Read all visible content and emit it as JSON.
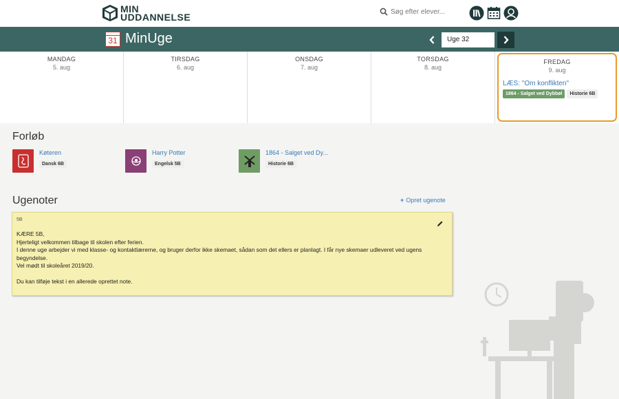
{
  "brand": {
    "line1": "MIN",
    "line2": "UDDANNELSE"
  },
  "search": {
    "placeholder": "Søg efter elever..."
  },
  "header": {
    "calendar_day": "31",
    "title": "MinUge",
    "week_label": "Uge 32"
  },
  "days": [
    {
      "name": "MANDAG",
      "date": "5. aug"
    },
    {
      "name": "TIRSDAG",
      "date": "6. aug"
    },
    {
      "name": "ONSDAG",
      "date": "7. aug"
    },
    {
      "name": "TORSDAG",
      "date": "8. aug"
    },
    {
      "name": "FREDAG",
      "date": "9. aug"
    }
  ],
  "friday_lesson": {
    "link": "LÆS: \"Om konflikten\"",
    "chips": [
      "1864 - Salget ved Dybbøl",
      "Historie 6B"
    ]
  },
  "forlob": {
    "title": "Forløb",
    "items": [
      {
        "name": "Køteren",
        "class": "Dansk 6B",
        "color": "#c8302f"
      },
      {
        "name": "Harry Potter",
        "class": "Engelsk 5B",
        "color": "#8a3f77"
      },
      {
        "name": "1864 - Salget ved Dy...",
        "class": "Historie 6B",
        "color": "#6f9c64"
      }
    ]
  },
  "ugenoter": {
    "title": "Ugenoter",
    "add_label": "Opret ugenote",
    "note": {
      "class": "5B",
      "lines": [
        "KÆRE 5B,",
        "Hjerteligt velkommen tilbage til skolen efter ferien.",
        "I denne uge arbejder vi med klasse- og kontaktlærerne, og bruger derfor ikke skemaet, sådan som det ellers er planlagt. I får nye skemaer udleveret ved ugens begyndelse.",
        "Vel mødt til skoleåret 2019/20.",
        "Du kan tilføje tekst i en allerede oprettet note."
      ]
    }
  },
  "colors": {
    "header_green": "#3c6663",
    "highlight_orange": "#e79a2f",
    "link_blue": "#3a7ab8",
    "note_yellow": "#f6f0b2"
  },
  "icons": [
    "logo-icon",
    "search-icon",
    "library-icon",
    "calendar-icon",
    "profile-icon",
    "chevron-left-icon",
    "chevron-right-icon",
    "plus-icon",
    "pencil-icon"
  ]
}
